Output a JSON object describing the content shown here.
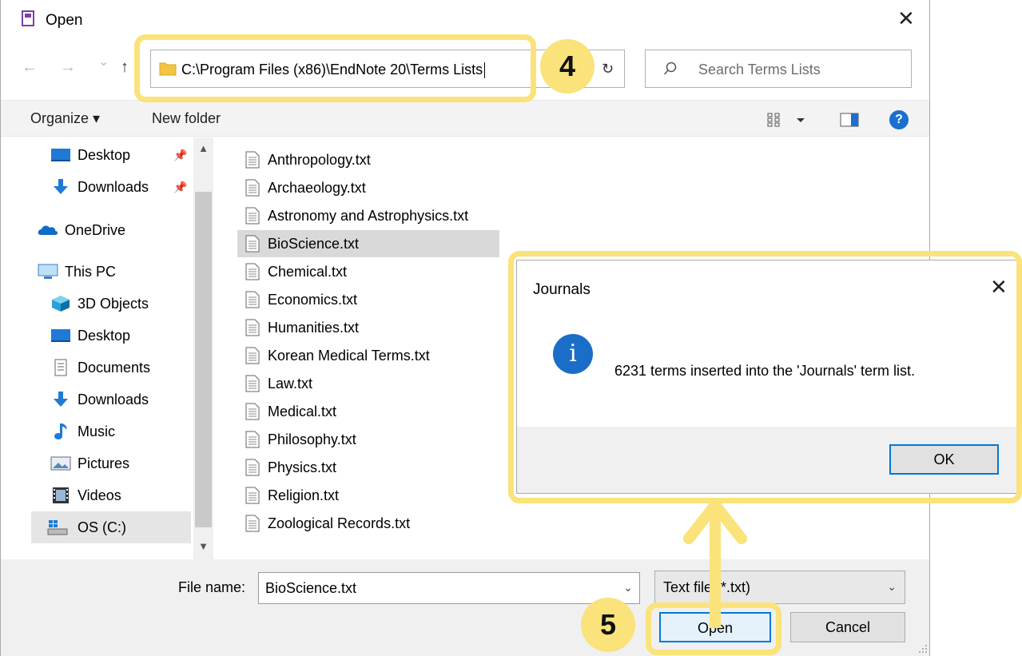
{
  "window": {
    "title": "Open",
    "close_label": "✕"
  },
  "nav": {
    "back": "←",
    "forward": "→",
    "recent": "⌄",
    "up": "↑",
    "refresh": "↻"
  },
  "address": {
    "path": "C:\\Program Files (x86)\\EndNote 20\\Terms Lists"
  },
  "search": {
    "placeholder": "Search Terms Lists"
  },
  "toolbar": {
    "organize_label": "Organize ▾",
    "new_folder_label": "New folder",
    "help_label": "?"
  },
  "sidebar": {
    "items": [
      {
        "label": "Desktop",
        "icon": "desktop-icon",
        "pinned": true
      },
      {
        "label": "Downloads",
        "icon": "downloads-icon",
        "pinned": true
      },
      {
        "label": "OneDrive",
        "icon": "cloud-icon"
      },
      {
        "label": "This PC",
        "icon": "computer-icon"
      },
      {
        "label": "3D Objects",
        "icon": "cube-icon"
      },
      {
        "label": "Desktop",
        "icon": "desktop-icon"
      },
      {
        "label": "Documents",
        "icon": "document-icon"
      },
      {
        "label": "Downloads",
        "icon": "downloads-icon"
      },
      {
        "label": "Music",
        "icon": "music-icon"
      },
      {
        "label": "Pictures",
        "icon": "pictures-icon"
      },
      {
        "label": "Videos",
        "icon": "video-icon"
      },
      {
        "label": "OS (C:)",
        "icon": "drive-icon",
        "selected": true
      }
    ]
  },
  "files": [
    {
      "name": "Anthropology.txt"
    },
    {
      "name": "Archaeology.txt"
    },
    {
      "name": "Astronomy and Astrophysics.txt"
    },
    {
      "name": "BioScience.txt",
      "selected": true
    },
    {
      "name": "Chemical.txt"
    },
    {
      "name": "Economics.txt"
    },
    {
      "name": "Humanities.txt"
    },
    {
      "name": "Korean Medical Terms.txt"
    },
    {
      "name": "Law.txt"
    },
    {
      "name": "Medical.txt"
    },
    {
      "name": "Philosophy.txt"
    },
    {
      "name": "Physics.txt"
    },
    {
      "name": "Religion.txt"
    },
    {
      "name": "Zoological Records.txt"
    }
  ],
  "bottom": {
    "filename_label": "File name:",
    "filename_value": "BioScience.txt",
    "filetype_value": "Text file (*.txt)",
    "open_label": "Open",
    "cancel_label": "Cancel"
  },
  "dialog": {
    "title": "Journals",
    "close_label": "✕",
    "message": "6231 terms inserted into the 'Journals' term list.",
    "ok_label": "OK",
    "info_glyph": "i"
  },
  "annotations": {
    "step4": "4",
    "step5": "5"
  },
  "colors": {
    "highlight": "#f9e37a",
    "accent": "#0078d7",
    "selection": "#d9d9d9"
  }
}
